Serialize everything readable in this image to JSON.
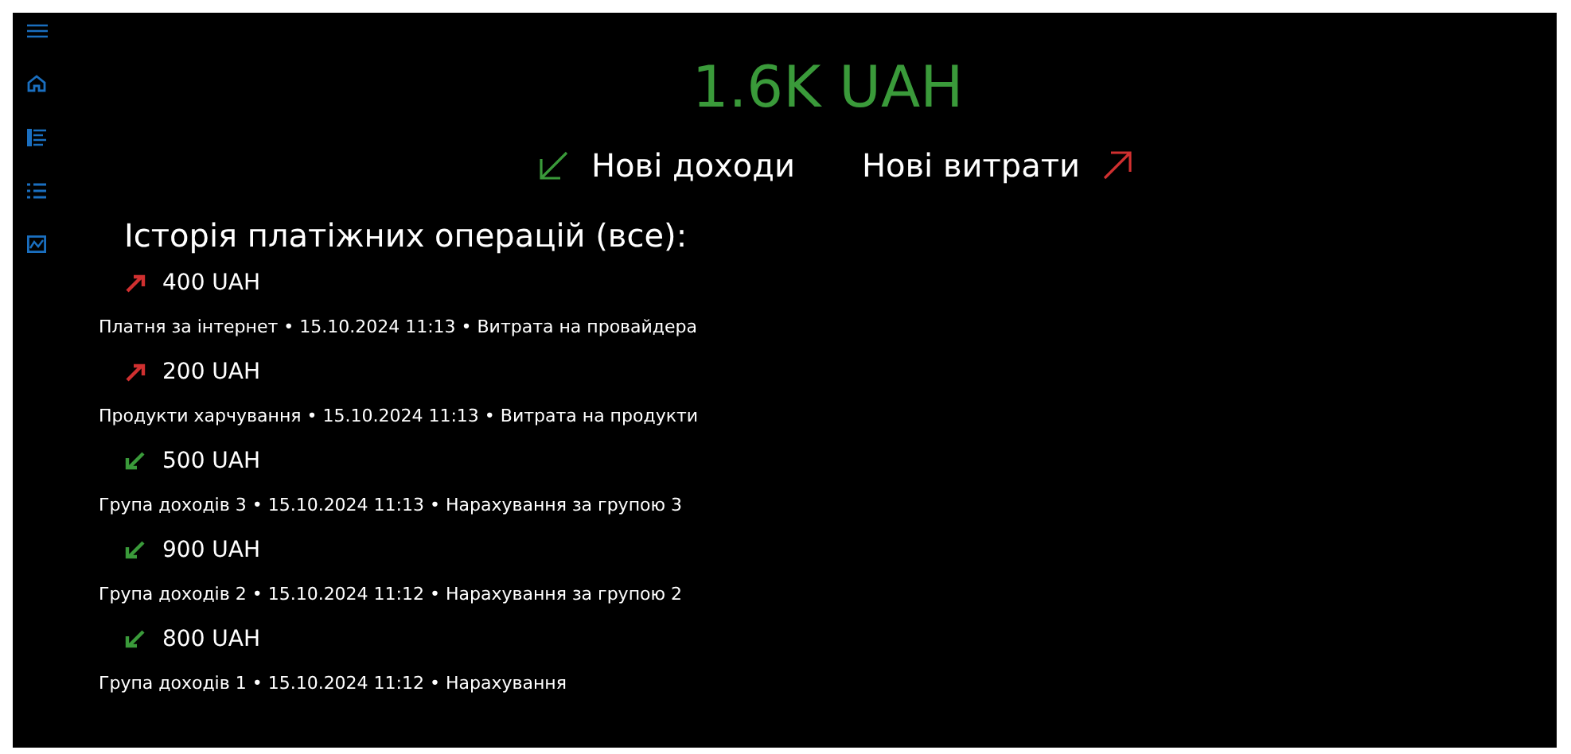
{
  "balance": "1.6K UAH",
  "actions": [
    {
      "kind": "income",
      "label": "Нові доходи"
    },
    {
      "kind": "expense",
      "label": "Нові витрати"
    }
  ],
  "history": {
    "title": "Історія платіжних операцій (все):",
    "items": [
      {
        "kind": "expense",
        "amount": "400 UAH",
        "details": "Платня за інтернет  •  15.10.2024 11:13  •  Витрата на провайдера"
      },
      {
        "kind": "expense",
        "amount": "200 UAH",
        "details": "Продукти харчування  •  15.10.2024 11:13  •  Витрата на продукти"
      },
      {
        "kind": "income",
        "amount": "500 UAH",
        "details": "Група доходів 3  •  15.10.2024 11:13  •  Нарахування за групою 3"
      },
      {
        "kind": "income",
        "amount": "900 UAH",
        "details": "Група доходів 2  •  15.10.2024 11:12  •  Нарахування за групою 2"
      },
      {
        "kind": "income",
        "amount": "800 UAH",
        "details": "Група доходів 1  •  15.10.2024 11:12  •  Нарахування"
      }
    ]
  }
}
